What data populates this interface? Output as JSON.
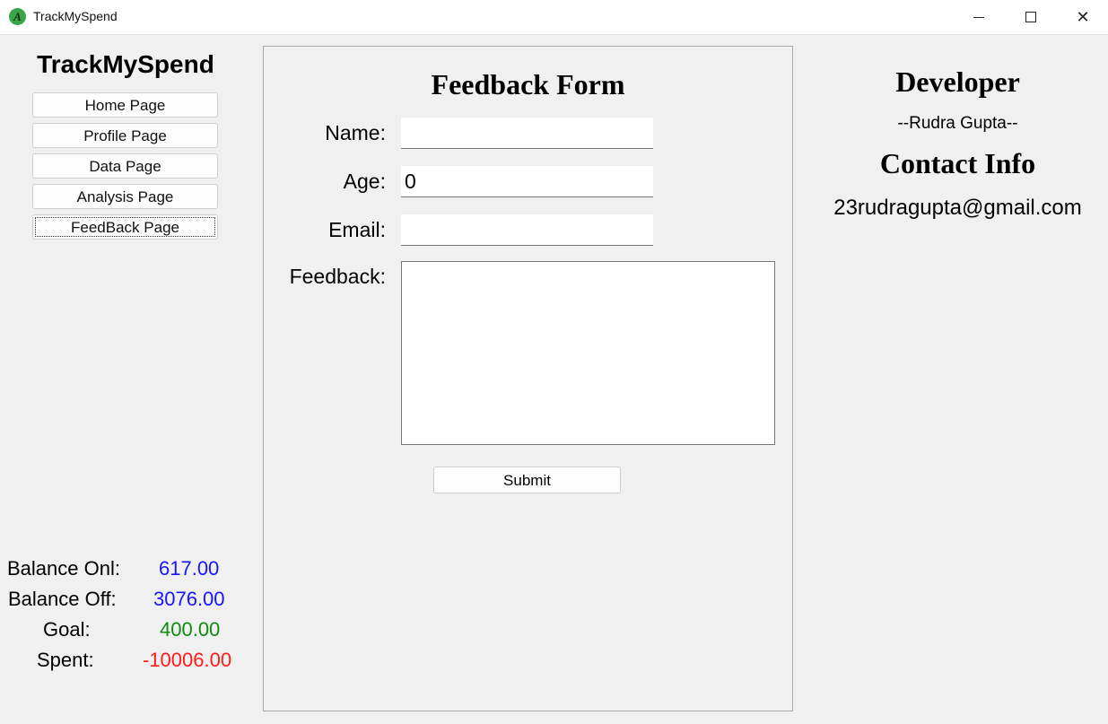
{
  "window": {
    "title": "TrackMySpend"
  },
  "sidebar": {
    "brand": "TrackMySpend",
    "nav": [
      {
        "label": "Home Page"
      },
      {
        "label": "Profile Page"
      },
      {
        "label": "Data Page"
      },
      {
        "label": "Analysis Page"
      },
      {
        "label": "FeedBack Page",
        "active": true
      }
    ],
    "balances": [
      {
        "label": "Balance Onl:",
        "value": "617.00",
        "color": "#1515ff"
      },
      {
        "label": "Balance Off:",
        "value": "3076.00",
        "color": "#1515ff"
      },
      {
        "label": "Goal:",
        "value": "400.00",
        "color": "#108a10"
      },
      {
        "label": "Spent:",
        "value": "-10006.00",
        "color": "#ff1a1a"
      }
    ]
  },
  "form": {
    "title": "Feedback Form",
    "name_label": "Name:",
    "name_value": "",
    "age_label": "Age:",
    "age_value": "0",
    "email_label": "Email:",
    "email_value": "",
    "feedback_label": "Feedback:",
    "feedback_value": "",
    "submit_label": "Submit"
  },
  "info": {
    "developer_heading": "Developer",
    "developer_name": "--Rudra Gupta--",
    "contact_heading": "Contact Info",
    "contact_email": "23rudragupta@gmail.com"
  }
}
